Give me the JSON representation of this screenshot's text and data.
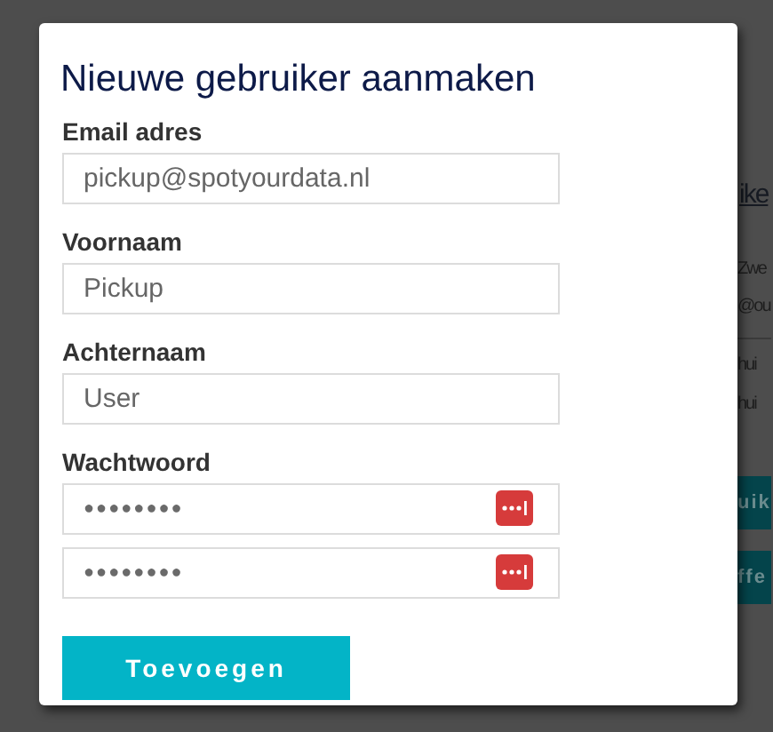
{
  "dialog": {
    "title": "Nieuwe gebruiker aanmaken",
    "fields": [
      {
        "kind": "text",
        "label": "Email adres",
        "value": "pickup@spotyourdata.nl"
      },
      {
        "kind": "text",
        "label": "Voornaam",
        "value": "Pickup"
      },
      {
        "kind": "text",
        "label": "Achternaam",
        "value": "User"
      },
      {
        "kind": "password",
        "label": "Wachtwoord",
        "value": "●●●●●●●●"
      },
      {
        "kind": "password",
        "value": "●●●●●●●●"
      }
    ],
    "submit": "Toevoegen"
  },
  "background": {
    "heading": "ike",
    "texts": [
      "Zwe",
      "@ou",
      "hui",
      "hui"
    ],
    "buttons": [
      "uik",
      "ffe"
    ]
  }
}
